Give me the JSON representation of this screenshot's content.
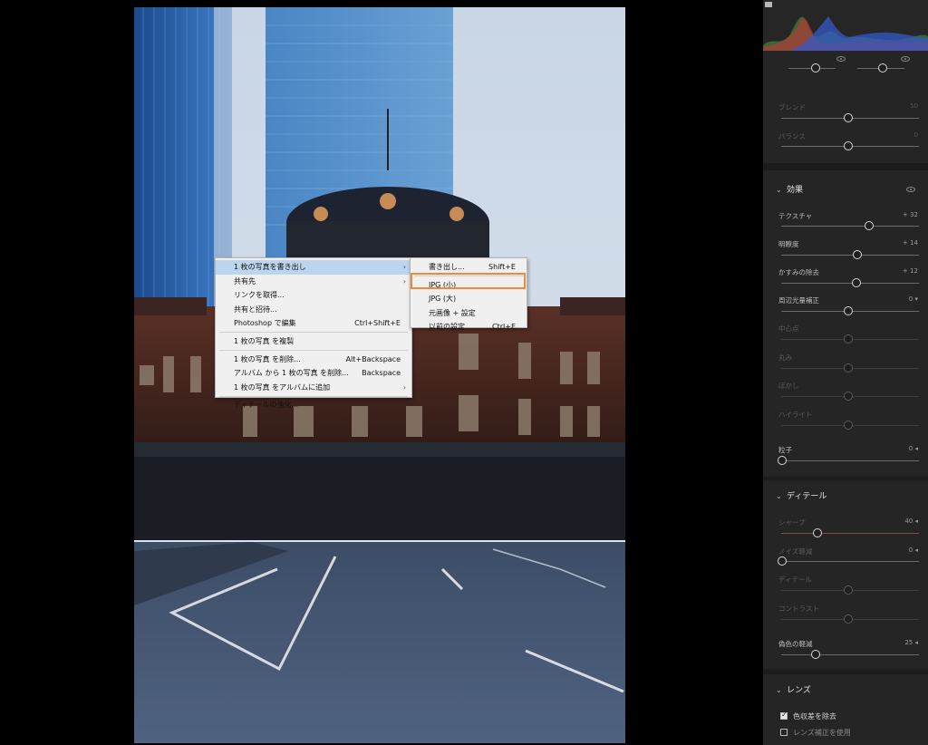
{
  "context_menu": {
    "items": [
      {
        "label": "1 枚の写真を書き出し",
        "shortcut": "",
        "submenu": true
      },
      {
        "label": "共有先",
        "shortcut": "",
        "submenu": true
      },
      {
        "label": "リンクを取得...",
        "shortcut": ""
      },
      {
        "label": "共有と招待...",
        "shortcut": ""
      },
      {
        "label": "Photoshop で編集",
        "shortcut": "Ctrl+Shift+E"
      },
      {
        "label": "1 枚の写真 を複製",
        "shortcut": ""
      },
      {
        "label": "1 枚の写真 を削除...",
        "shortcut": "Alt+Backspace"
      },
      {
        "label": "アルバム から 1 枚の写真 を削除...",
        "shortcut": "Backspace"
      },
      {
        "label": "1 枚の写真 をアルバムに追加",
        "shortcut": "",
        "submenu": true
      },
      {
        "label": "ディテールの強化...",
        "shortcut": ""
      }
    ]
  },
  "export_submenu": {
    "items": [
      {
        "label": "書き出し...",
        "shortcut": "Shift+E"
      },
      {
        "label": "JPG (小)",
        "shortcut": ""
      },
      {
        "label": "JPG (大)",
        "shortcut": ""
      },
      {
        "label": "元画像 + 設定",
        "shortcut": ""
      },
      {
        "label": "以前の設定",
        "shortcut": "Ctrl+E"
      }
    ]
  },
  "panel": {
    "color_grading": {
      "blend": {
        "label": "ブレンド",
        "value": "50"
      },
      "balance": {
        "label": "バランス",
        "value": "0"
      }
    },
    "effects": {
      "title": "効果",
      "texture": {
        "label": "テクスチャ",
        "value": "+ 32"
      },
      "clarity": {
        "label": "明瞭度",
        "value": "+ 14"
      },
      "dehaze": {
        "label": "かすみの除去",
        "value": "+ 12"
      },
      "vignette": {
        "label": "周辺光量補正",
        "value": "0"
      },
      "midpoint": {
        "label": "中心点"
      },
      "roundness": {
        "label": "丸み"
      },
      "feather": {
        "label": "ぼかし"
      },
      "highlights": {
        "label": "ハイライト"
      },
      "grain": {
        "label": "粒子",
        "value": "0"
      }
    },
    "detail": {
      "title": "ディテール",
      "sharpening": {
        "label": "シャープ",
        "value": "40"
      },
      "noise_reduction": {
        "label": "ノイズ軽減",
        "value": "0"
      },
      "nr_detail": {
        "label": "ディテール"
      },
      "nr_contrast": {
        "label": "コントラスト"
      },
      "color_noise": {
        "label": "偽色の軽減",
        "value": "25"
      }
    },
    "lens": {
      "title": "レンズ",
      "remove_ca": {
        "label": "色収差を除去",
        "checked": true
      },
      "enable_profile": {
        "label": "レンズ補正を使用",
        "checked": false
      }
    }
  },
  "colors": {
    "highlight": "#bcd5ee",
    "focus_outline": "#e98b3a",
    "panel_bg": "#1c1c1c",
    "section_bg": "#252525"
  }
}
